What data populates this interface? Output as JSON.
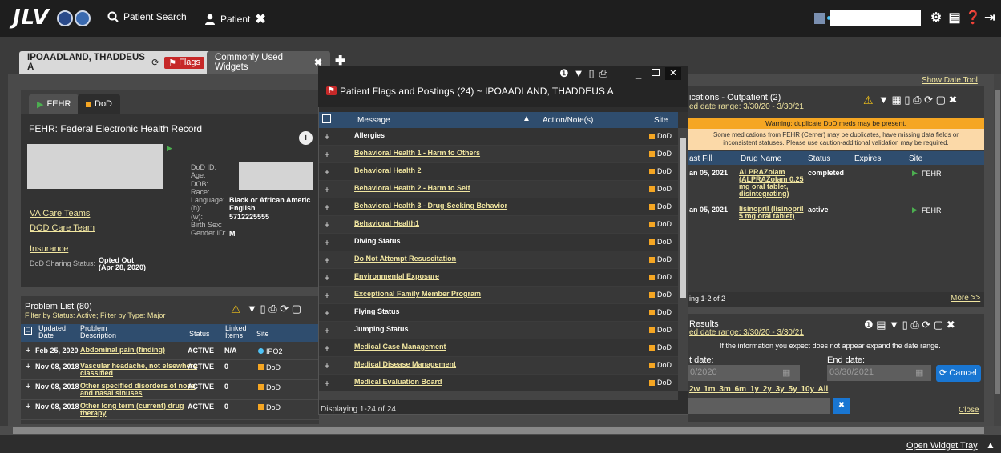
{
  "app": {
    "logo": "JLV"
  },
  "topbar": {
    "patient_search": "Patient Search",
    "patient": "Patient"
  },
  "tabs": {
    "patient_tab": "IPOAADLAND, THADDEUS A",
    "flags": "Flags",
    "widgets_tab": "Commonly Used Widgets"
  },
  "fehr": {
    "tab_fehr": "FEHR",
    "tab_dod": "DoD",
    "title": "FEHR: Federal Electronic Health Record",
    "labels": [
      "DoD ID:",
      "Age:",
      "DOB:",
      "Race:",
      "Language:",
      "(h):",
      "(w):",
      "Birth Sex:",
      "Gender ID:"
    ],
    "race": "Black or African Americ",
    "language": "English",
    "phone_h": "5712225555",
    "birth_sex": "M",
    "va_care_teams": "VA Care Teams",
    "dod_care_team": "DOD Care Team",
    "insurance": "Insurance",
    "sharing_label": "DoD Sharing Status:",
    "sharing_value": "Opted Out",
    "sharing_date": "(Apr 28, 2020)"
  },
  "problems": {
    "title": "Problem List (80)",
    "filter": "Filter by Status: Active; Filter by Type: Major",
    "headers": [
      "Updated Date",
      "Problem Description",
      "Status",
      "Linked Items",
      "Site"
    ],
    "rows": [
      {
        "date": "Feb 25, 2020",
        "desc": "Abdominal pain (finding)",
        "status": "ACTIVE",
        "linked": "N/A",
        "site": "IPO2",
        "site_color": "#4fc3f7"
      },
      {
        "date": "Nov 08, 2018",
        "desc": "Vascular headache, not elsewhere classified",
        "status": "ACTIVE",
        "linked": "0",
        "site": "DoD",
        "site_color": "#f5a623"
      },
      {
        "date": "Nov 08, 2018",
        "desc": "Other specified disorders of nose and nasal sinuses",
        "status": "ACTIVE",
        "linked": "0",
        "site": "DoD",
        "site_color": "#f5a623"
      },
      {
        "date": "Nov 08, 2018",
        "desc": "Other long term (current) drug therapy",
        "status": "ACTIVE",
        "linked": "0",
        "site": "DoD",
        "site_color": "#f5a623"
      }
    ]
  },
  "modal": {
    "title": "Patient Flags and Postings (24) ~ IPOAADLAND, THADDEUS A",
    "headers": {
      "message": "Message",
      "action": "Action/Note(s)",
      "site": "Site"
    },
    "rows": [
      {
        "msg": "Allergies",
        "link": false,
        "site": "DoD"
      },
      {
        "msg": "Behavioral Health 1 - Harm to Others",
        "link": true,
        "site": "DoD"
      },
      {
        "msg": "Behavioral Health 2",
        "link": true,
        "site": "DoD"
      },
      {
        "msg": "Behavioral Health 2 - Harm to Self",
        "link": true,
        "site": "DoD"
      },
      {
        "msg": "Behavioral Health 3 - Drug-Seeking Behavior",
        "link": true,
        "site": "DoD"
      },
      {
        "msg": "Behavioral Health1",
        "link": true,
        "site": "DoD"
      },
      {
        "msg": "Diving Status",
        "link": false,
        "site": "DoD"
      },
      {
        "msg": "Do Not Attempt Resuscitation",
        "link": true,
        "site": "DoD"
      },
      {
        "msg": "Environmental Exposure",
        "link": true,
        "site": "DoD"
      },
      {
        "msg": "Exceptional Family Member Program",
        "link": true,
        "site": "DoD"
      },
      {
        "msg": "Flying Status",
        "link": false,
        "site": "DoD"
      },
      {
        "msg": "Jumping Status",
        "link": false,
        "site": "DoD"
      },
      {
        "msg": "Medical Case Management",
        "link": true,
        "site": "DoD"
      },
      {
        "msg": "Medical Disease Management",
        "link": true,
        "site": "DoD"
      },
      {
        "msg": "Medical Evaluation Board",
        "link": true,
        "site": "DoD"
      }
    ],
    "footer": "Displaying 1-24 of 24"
  },
  "meds": {
    "title": "ications - Outpatient (2)",
    "date_range": "ed date range: 3/30/20 - 3/30/21",
    "warning": "Warning: duplicate DoD meds may be present.",
    "notice": "Some medications from FEHR (Cerner) may be duplicates, have missing data fields or inconsistent statuses. Please use caution-additional validation may be required.",
    "headers": [
      "ast Fill",
      "Drug Name",
      "Status",
      "Expires",
      "Site"
    ],
    "rows": [
      {
        "fill": "an 05, 2021",
        "drug": "ALPRAZolam (ALPRAZolam 0.25 mg oral tablet, disintegrating)",
        "status": "completed",
        "expires": "",
        "site": "FEHR"
      },
      {
        "fill": "an 05, 2021",
        "drug": "lisinopril (lisinopril 5 mg oral tablet)",
        "status": "active",
        "expires": "",
        "site": "FEHR"
      }
    ],
    "showing": "ing 1-2 of 2",
    "more": "More >>"
  },
  "labs": {
    "title": "Results",
    "date_range": "ed date range: 3/30/20 - 3/30/21",
    "info": "If the information you expect does not appear expand the date range.",
    "start_label": "t date:",
    "end_label": "End date:",
    "start_value": "0/2020",
    "end_value": "03/30/2021",
    "cancel": "Cancel",
    "ranges": "2w  1m  3m  6m  1y  2y  3y  5y  10y  All",
    "close": "Close"
  },
  "show_date_tool": "Show Date Tool",
  "open_widget_tray": "Open Widget Tray"
}
